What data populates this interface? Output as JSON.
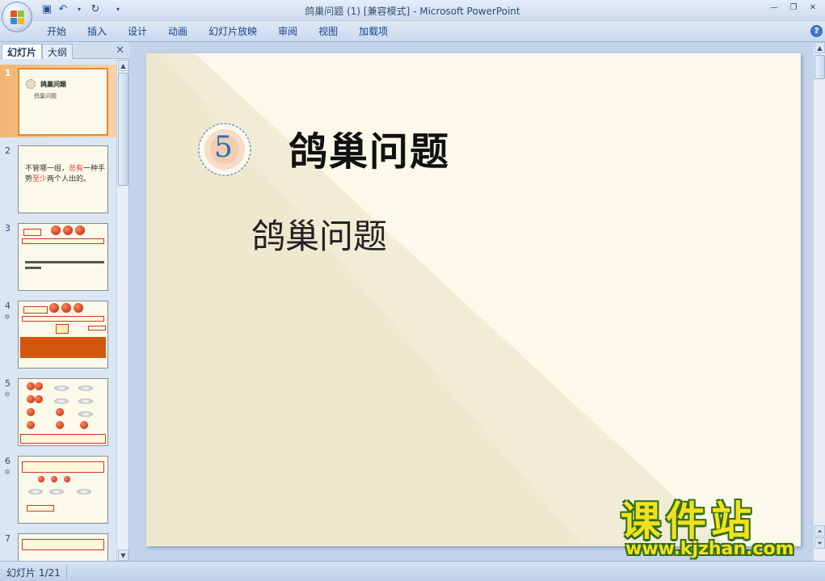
{
  "window": {
    "title_doc": "鸽巢问题 (1) [兼容模式]",
    "title_sep": " - ",
    "title_app": "Microsoft PowerPoint"
  },
  "qat": {
    "icons": [
      "save-icon",
      "undo-icon",
      "dropdown-icon",
      "redo-icon",
      "customize-icon"
    ]
  },
  "window_controls": {
    "minimize": "—",
    "restore": "❐",
    "close": "✕"
  },
  "ribbon": {
    "tabs": [
      "开始",
      "插入",
      "设计",
      "动画",
      "幻灯片放映",
      "审阅",
      "视图",
      "加载项"
    ],
    "help": "?"
  },
  "left_pane": {
    "tab_slides": "幻灯片",
    "tab_outline": "大纲",
    "close": "✕",
    "thumbnails": [
      {
        "num": "1",
        "anim": "",
        "title": "鸽巢问题",
        "subtitle": "鸽巢问题"
      },
      {
        "num": "2",
        "anim": "",
        "text_a": "不管哪一组，",
        "text_red1": "总有",
        "text_b": "一种手势",
        "text_red2": "至少",
        "text_c": "两个人出的。"
      },
      {
        "num": "3",
        "anim": ""
      },
      {
        "num": "4",
        "anim": "✲"
      },
      {
        "num": "5",
        "anim": "✲"
      },
      {
        "num": "6",
        "anim": "✲"
      },
      {
        "num": "7",
        "anim": ""
      }
    ]
  },
  "slide": {
    "badge_number": "5",
    "title": "鸽巢问题",
    "subtitle": "鸽巢问题"
  },
  "watermark": {
    "cn": "课件站",
    "url": "www.kjzhan.com"
  },
  "status": {
    "slide_counter": "幻灯片 1/21"
  }
}
